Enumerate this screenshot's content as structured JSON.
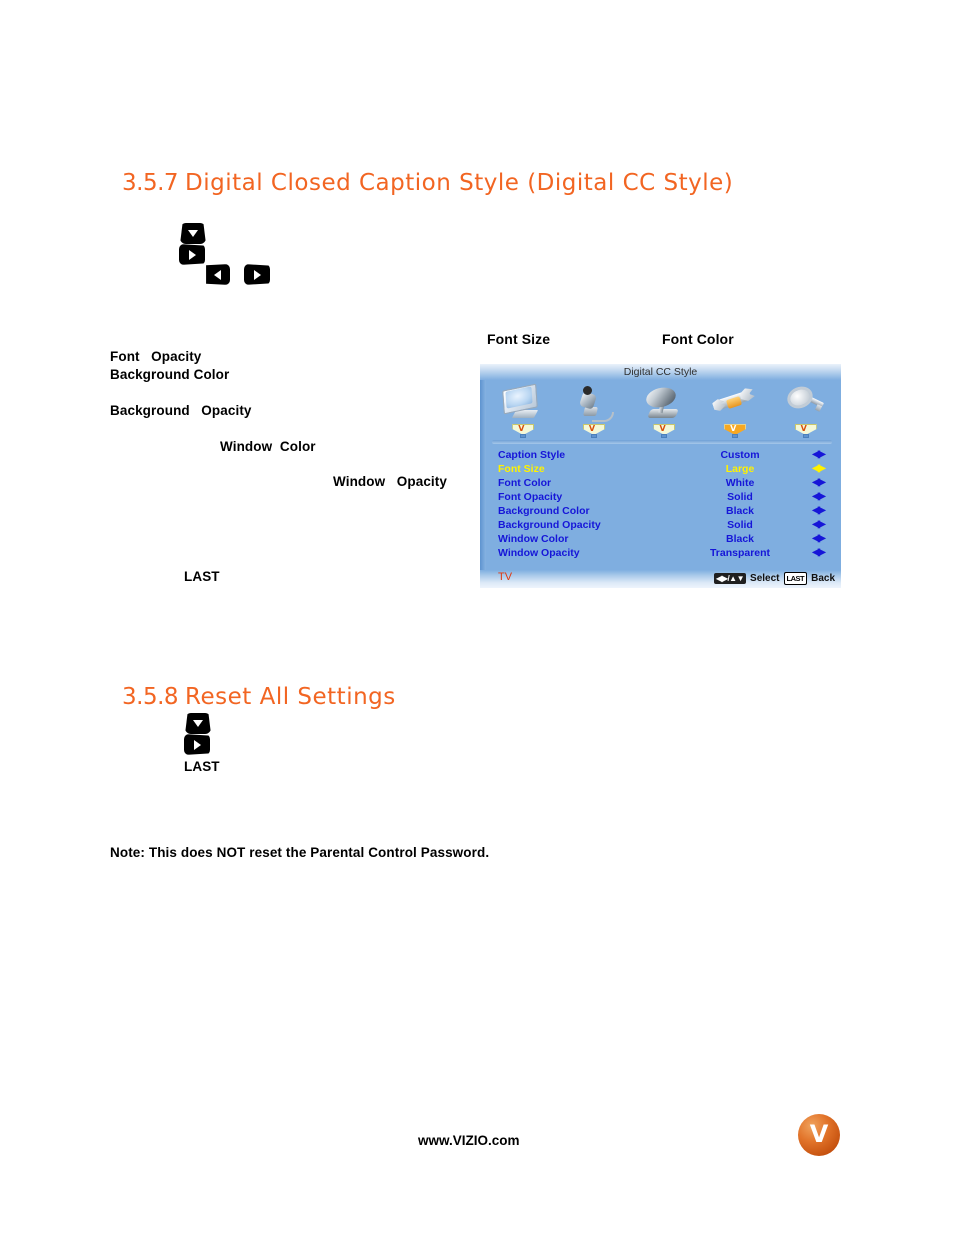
{
  "page": {
    "sections": [
      {
        "number": "3.5.7",
        "title": "Digital Closed Caption Style (Digital CC Style)"
      },
      {
        "number": "3.5.8",
        "title": "Reset All Settings"
      }
    ],
    "body_fragments": [
      {
        "text": "Font   Opacity"
      },
      {
        "text": "Background Color"
      },
      {
        "text": "Background   Opacity"
      },
      {
        "text": "Window  Color"
      },
      {
        "text": "Window   Opacity"
      },
      {
        "text": "LAST"
      },
      {
        "text": "LAST"
      }
    ],
    "note": "Note: This does NOT reset the Parental Control Password."
  },
  "callouts": {
    "font_size": "Font Size",
    "font_color": "Font Color"
  },
  "remote_keys": {
    "k1": "down-arrow",
    "k2": "right-arrow",
    "k3": "left-arrow",
    "k4": "right-arrow",
    "k5": "down-arrow",
    "k6": "right-arrow"
  },
  "osd": {
    "title": "Digital CC Style",
    "icons": [
      {
        "name": "tv-monitor-icon",
        "selected": false
      },
      {
        "name": "microphone-audio-icon",
        "selected": false
      },
      {
        "name": "satellite-dish-tuner-icon",
        "selected": false
      },
      {
        "name": "wrench-setup-icon",
        "selected": true
      },
      {
        "name": "key-parental-icon",
        "selected": false
      }
    ],
    "rows": [
      {
        "label": "Caption Style",
        "value": "Custom",
        "active": false
      },
      {
        "label": "Font Size",
        "value": "Large",
        "active": true
      },
      {
        "label": "Font Color",
        "value": "White",
        "active": false
      },
      {
        "label": "Font Opacity",
        "value": "Solid",
        "active": false
      },
      {
        "label": "Background Color",
        "value": "Black",
        "active": false
      },
      {
        "label": "Background Opacity",
        "value": "Solid",
        "active": false
      },
      {
        "label": "Window Color",
        "value": "Black",
        "active": false
      },
      {
        "label": "Window Opacity",
        "value": "Transparent",
        "active": false
      }
    ],
    "adjust_glyph": "◀▶",
    "footer": {
      "source": "TV",
      "select_keys": "◀▶/▲▼",
      "select_label": "Select",
      "back_key": "LAST",
      "back_label": "Back"
    }
  },
  "footer": {
    "url": "www.VIZIO.com",
    "logo_letter": "V"
  },
  "colors": {
    "heading_orange": "#F26522",
    "osd_background": "#7FAEE0",
    "osd_text_blue": "#1616D8",
    "osd_highlight_yellow": "#FFF200",
    "osd_source_red": "#E03A10",
    "brand_orange": "#D8500E"
  }
}
